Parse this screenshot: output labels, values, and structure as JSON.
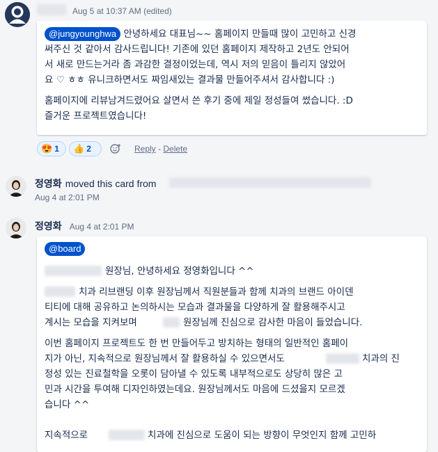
{
  "comment1": {
    "timestamp": "Aug 5 at 10:37 AM (edited)",
    "mention": "@jungyounghwa",
    "lines": [
      "안녕하세요 대표님~~ 홈페이지 만들때 많이 고민하고 신경",
      "써주신 것 같아서 감사드립니다! 기존에 있던 홈페이지 제작하고 2년도 안되어",
      "서 새로 만드는거라 좀 과감한 결정이었는데, 역시 저의 믿음이 틀리지 않았어",
      "요 ♡ ㅎㅎ 유니크하면서도 짜임새있는 결과물 만들어주셔서 감사합니다 :)"
    ],
    "lines2": [
      "홈페이지에 리뷰남겨드렸어요 살면서 쓴 후기 중에 제일 정성들여 썼습니다. :D",
      "즐거운 프로젝트였습니다!"
    ],
    "reactions": [
      {
        "emoji": "😍",
        "count": "1"
      },
      {
        "emoji": "👍",
        "count": "2"
      }
    ],
    "reply_label": "Reply",
    "separator": " - ",
    "delete_label": "Delete"
  },
  "activity": {
    "author": "정영화",
    "action": "moved this card from",
    "timestamp": "Aug 4 at 2:01 PM"
  },
  "comment2": {
    "author": "정영화",
    "timestamp": "Aug 4 at 2:01 PM",
    "mention": "@board",
    "greeting": "원장님, 안녕하세요 정영화입니다 ^^",
    "p1": [
      "치과 리브랜딩 이후 원장님께서 직원분들과 함께 치과의 브랜드 아이덴",
      "티티에 대해 공유하고 논의하시는 모습과 결과물을 다양하게 잘 활용해주시고",
      "계시는 모습을 지켜보며",
      "원장님께 진심으로 감사한 마음이 들었습니다."
    ],
    "p2": [
      "이번 홈페이지 프로젝트도 한 번 만들어두고 방치하는 형태의 일반적인 홈페이",
      "지가 아닌, 지속적으로 원장님께서 잘 활용하실 수 있으면서도",
      "치과의 진",
      "정성 있는 진료철학을 오롯이 담아낼 수 있도록 내부적으로도 상당히 많은 고",
      "민과 시간을 투여해 디자인하였는데요. 원장님께서도 마음에 드셨을지 모르겠",
      "습니다 ^^"
    ],
    "p3_start": "지속적으로",
    "p3_end": "치과에 진심으로 도움이 되는 방향이 무엇인지 함께 고민하"
  },
  "colors": {
    "accent": "#0052cc",
    "background": "#f4f5f7",
    "text": "#172b4d",
    "meta": "#5e6c84"
  }
}
